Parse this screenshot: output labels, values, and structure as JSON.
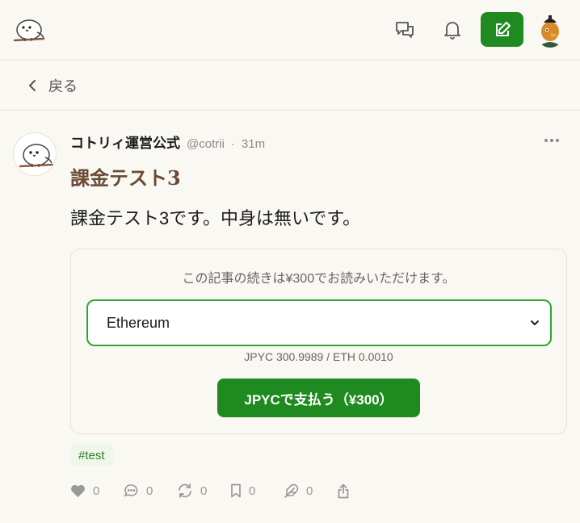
{
  "header": {
    "icons": [
      "bird-logo-icon",
      "messages-icon",
      "bell-icon",
      "edit-icon",
      "user-avatar"
    ]
  },
  "back": {
    "label": "戻る"
  },
  "post": {
    "author": "コトリィ運営公式",
    "handle": "@cotrii",
    "separator": "·",
    "time": "31m",
    "title": "課金テスト3",
    "body": "課金テスト3です。中身は無いです。",
    "paywall": {
      "message": "この記事の続きは¥300でお読みいただけます。",
      "selected_currency": "Ethereum",
      "price_info": "JPYC 300.9989 / ETH 0.0010",
      "pay_label": "JPYCで支払う（¥300）"
    },
    "tag": "#test",
    "actions": [
      {
        "name": "like",
        "count": "0"
      },
      {
        "name": "reply",
        "count": "0"
      },
      {
        "name": "repost",
        "count": "0"
      },
      {
        "name": "bookmark",
        "count": "0"
      },
      {
        "name": "quote",
        "count": "0"
      }
    ]
  },
  "colors": {
    "accent": "#1f8a1f",
    "title": "#6b4a36",
    "background": "#faf8f2"
  }
}
